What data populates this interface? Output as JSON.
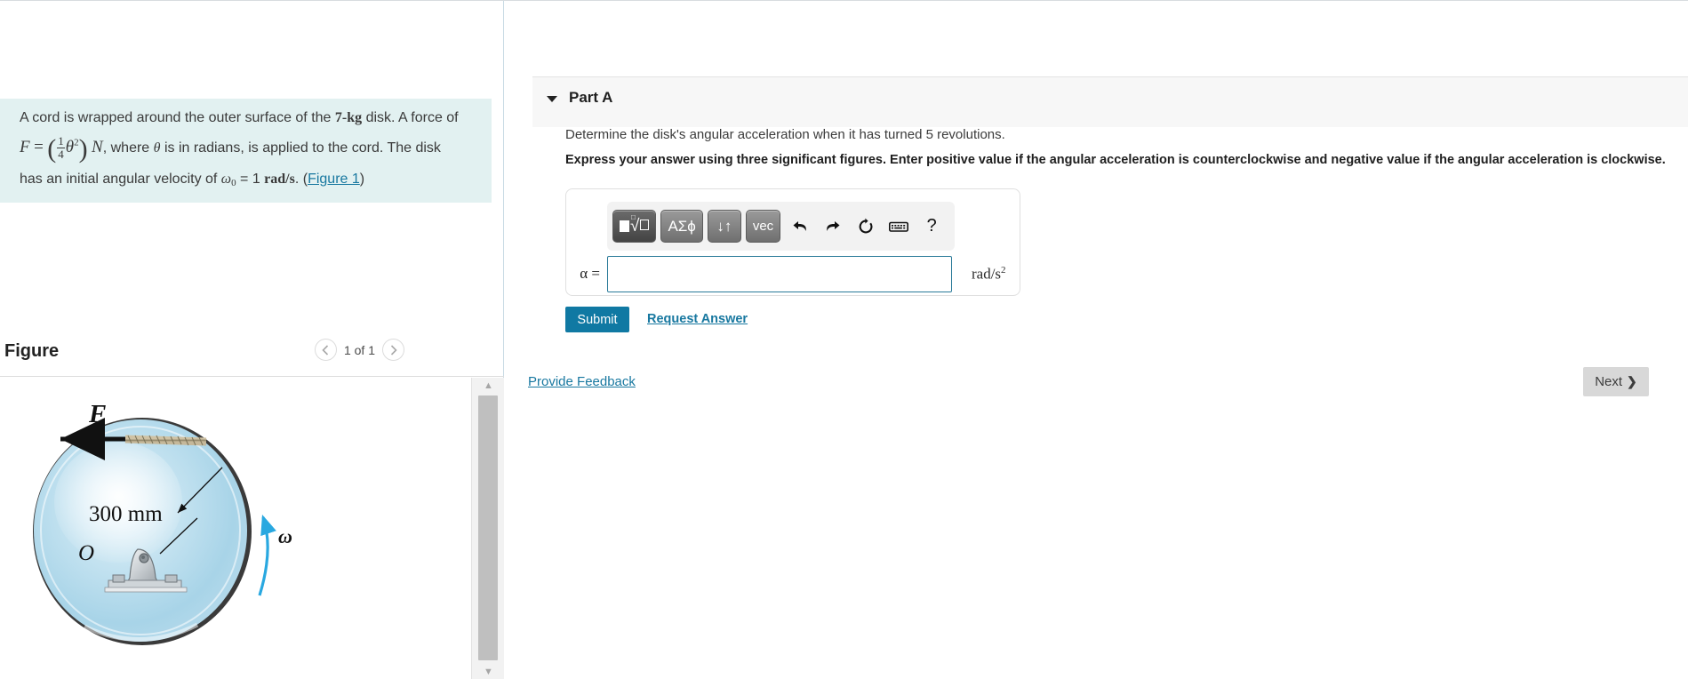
{
  "problem": {
    "line1_a": "A cord is wrapped around the outer surface of the ",
    "mass_value": "7-",
    "mass_unit": "kg",
    "line1_b": " disk. A force of",
    "force_symbol": "F",
    "equals": "=",
    "frac_num": "1",
    "frac_den": "4",
    "theta": "θ",
    "exponent": "2",
    "force_unit": "N",
    "line2_b": ", where ",
    "theta_inline": "θ",
    "line2_c": " is in radians, is applied to the cord. The disk",
    "line3_a": "has an initial angular velocity of ",
    "omega_symbol": "ω",
    "omega_sub": "0",
    "omega_eq": " = 1 ",
    "omega_unit": "rad/s",
    "line3_b": ". (",
    "figure_link": "Figure 1",
    "line3_c": ")"
  },
  "figure": {
    "title": "Figure",
    "page_indicator": "1 of 1",
    "prev_icon": "chevron-left-icon",
    "next_icon": "chevron-right-icon",
    "force_label": "F",
    "radius_label": "300 mm",
    "center_label": "O",
    "omega_label": "ω"
  },
  "part": {
    "label": "Part A",
    "caret_icon": "caret-down-icon",
    "question": "Determine the disk's angular acceleration when it has turned 5 revolutions.",
    "instruction": "Express your answer using three significant figures. Enter positive value if the angular acceleration is counterclockwise and negative value if the angular acceleration is clockwise."
  },
  "toolbar": {
    "keys": [
      {
        "name": "template-sqrt-key",
        "label": "■√□"
      },
      {
        "name": "greek-symbols-key",
        "label": "ΑΣϕ"
      },
      {
        "name": "subscript-superscript-key",
        "label": "↓↑"
      },
      {
        "name": "vector-key",
        "label": "vec"
      }
    ],
    "undo_icon": "undo-arrow-icon",
    "redo_icon": "redo-arrow-icon",
    "reset_icon": "reset-circular-arrow-icon",
    "keyboard_icon": "keyboard-icon",
    "help_label": "?"
  },
  "answer": {
    "variable_label": "α =",
    "value": "",
    "placeholder": "",
    "units_base": "rad/s",
    "units_exp": "2"
  },
  "actions": {
    "submit_label": "Submit",
    "request_answer_label": "Request Answer",
    "provide_feedback_label": "Provide Feedback",
    "next_label": "Next",
    "next_chevron": "❯"
  },
  "colors": {
    "accent_teal": "#1079a3",
    "link_blue": "#1878a0",
    "problem_bg": "#e2f1f1",
    "part_header_bg": "#f7f7f7",
    "next_button_bg": "#d8d8d8",
    "input_border": "#2a7a99",
    "omega_arrow": "#29a8e0"
  },
  "scrollbar": {
    "up_icon": "scroll-up-arrow-icon",
    "down_icon": "scroll-down-arrow-icon"
  }
}
